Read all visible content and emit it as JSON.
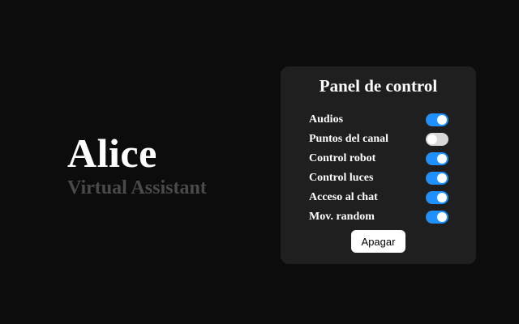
{
  "brand": {
    "title": "Alice",
    "subtitle": "Virtual Assistant"
  },
  "panel": {
    "title": "Panel de control",
    "items": [
      {
        "label": "Audios",
        "enabled": true
      },
      {
        "label": "Puntos del canal",
        "enabled": false
      },
      {
        "label": "Control robot",
        "enabled": true
      },
      {
        "label": "Control luces",
        "enabled": true
      },
      {
        "label": "Acceso al chat",
        "enabled": true
      },
      {
        "label": "Mov. random",
        "enabled": true
      }
    ],
    "button_label": "Apagar"
  },
  "colors": {
    "background": "#0c0c0c",
    "panel": "#1f1f1f",
    "toggle_on": "#1e90ff",
    "toggle_off": "#d8d8d8",
    "subtitle": "#4a4a4a"
  }
}
